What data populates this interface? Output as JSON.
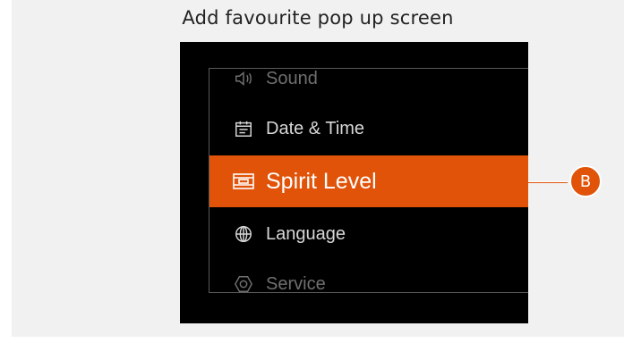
{
  "caption": "Add favourite pop up screen",
  "menu": {
    "items": [
      {
        "label": "Sound",
        "icon": "speaker-icon",
        "state": "faded"
      },
      {
        "label": "Date & Time",
        "icon": "calendar-icon",
        "state": "normal"
      },
      {
        "label": "Spirit Level",
        "icon": "spirit-level-icon",
        "state": "selected"
      },
      {
        "label": "Language",
        "icon": "globe-icon",
        "state": "normal"
      },
      {
        "label": "Service",
        "icon": "hexagon-icon",
        "state": "faded"
      }
    ]
  },
  "callout": {
    "label": "B"
  },
  "colors": {
    "accent": "#e05309",
    "screen_background": "#000000",
    "panel_background": "#f1f1f1"
  }
}
